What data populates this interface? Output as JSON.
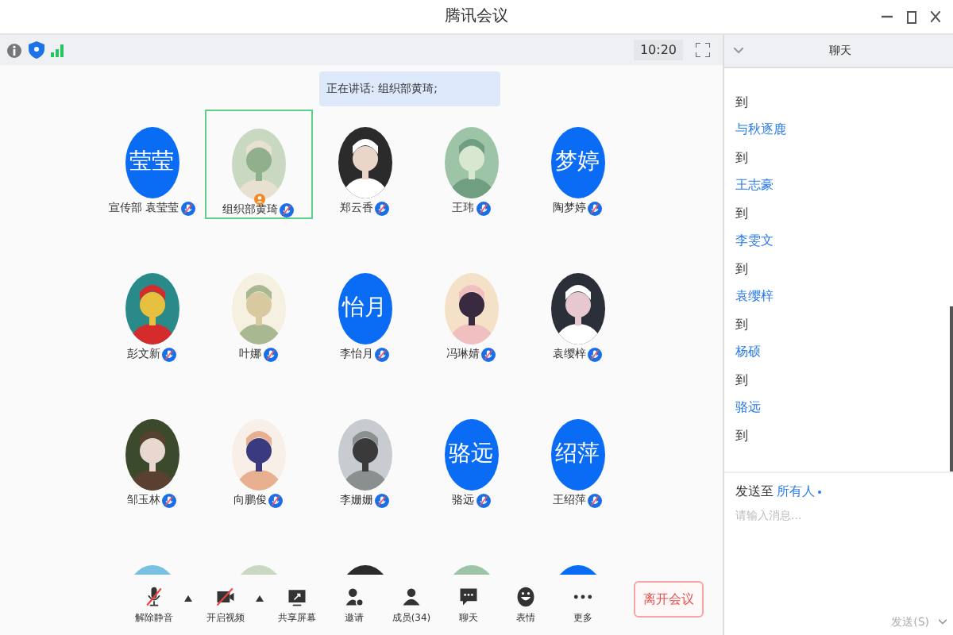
{
  "window": {
    "title": "腾讯会议"
  },
  "status": {
    "time": "10:20"
  },
  "speaking_banner": "正在讲话: 组织部黄琦;",
  "participants": [
    {
      "kind": "text",
      "avatar_text": "莹莹",
      "name": "宣传部 袁莹莹",
      "speaking": false
    },
    {
      "kind": "picture",
      "name": "组织部黄琦",
      "speaking": true
    },
    {
      "kind": "picture",
      "name": "郑云香",
      "speaking": false
    },
    {
      "kind": "picture",
      "name": "王玮",
      "speaking": false
    },
    {
      "kind": "text",
      "avatar_text": "梦婷",
      "name": "陶梦婷",
      "speaking": false
    },
    {
      "kind": "picture",
      "name": "彭文新",
      "speaking": false
    },
    {
      "kind": "picture",
      "name": "叶娜",
      "speaking": false
    },
    {
      "kind": "text",
      "avatar_text": "怡月",
      "name": "李怡月",
      "speaking": false
    },
    {
      "kind": "picture",
      "name": "冯琳婧",
      "speaking": false
    },
    {
      "kind": "picture",
      "name": "袁缨梓",
      "speaking": false
    },
    {
      "kind": "picture",
      "name": "邹玉林",
      "speaking": false
    },
    {
      "kind": "picture",
      "name": "向鹏俊",
      "speaking": false
    },
    {
      "kind": "picture",
      "name": "李姗姗",
      "speaking": false
    },
    {
      "kind": "text",
      "avatar_text": "骆远",
      "name": "骆远",
      "speaking": false
    },
    {
      "kind": "text",
      "avatar_text": "绍萍",
      "name": "王绍萍",
      "speaking": false
    },
    {
      "kind": "picture"
    },
    {
      "kind": "picture"
    },
    {
      "kind": "picture"
    },
    {
      "kind": "picture"
    },
    {
      "kind": "blank"
    }
  ],
  "toolbar": [
    {
      "kind": "mic",
      "label": "解除静音",
      "caret": true
    },
    {
      "kind": "video",
      "label": "开启视频",
      "caret": true
    },
    {
      "kind": "share",
      "label": "共享屏幕",
      "caret": false
    },
    {
      "kind": "invite",
      "label": "邀请",
      "caret": false
    },
    {
      "kind": "members",
      "label": "成员(34)",
      "caret": false
    },
    {
      "kind": "chat",
      "label": "聊天",
      "caret": false
    },
    {
      "kind": "emoji",
      "label": "表情",
      "caret": false
    },
    {
      "kind": "more",
      "label": "更多",
      "caret": false
    }
  ],
  "leave_button": "离开会议",
  "chat": {
    "title": "聊天",
    "messages": [
      {
        "text": "到"
      },
      {
        "sender": "与秋逐鹿",
        "text": "到"
      },
      {
        "sender": "王志豪",
        "text": "到"
      },
      {
        "sender": "李雯文",
        "text": "到"
      },
      {
        "sender": "袁缨梓",
        "text": "到"
      },
      {
        "sender": "杨硕",
        "text": "到"
      },
      {
        "sender": "骆远",
        "text": "到"
      }
    ],
    "send_to_label": "发送至",
    "recipient": "所有人",
    "placeholder": "请输入消息...",
    "send_button": "发送(S)"
  }
}
